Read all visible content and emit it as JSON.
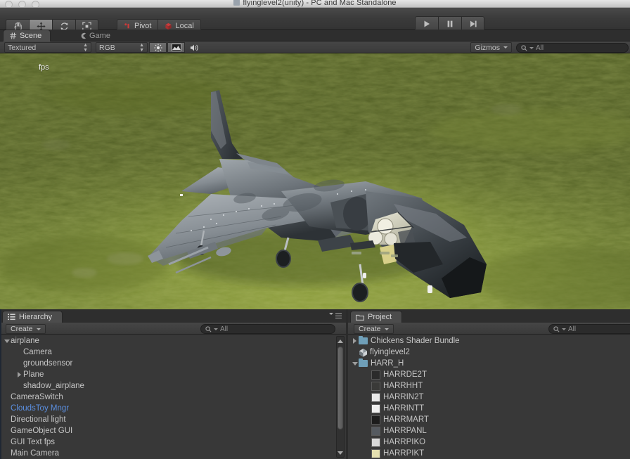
{
  "window": {
    "title": "flyinglevel2(unity) - PC and Mac Standalone",
    "buttons": [
      "close",
      "minimize",
      "zoom"
    ]
  },
  "toolbar": {
    "transform_tools": [
      {
        "name": "hand-tool",
        "icon": "hand-icon",
        "selected": false
      },
      {
        "name": "move-tool",
        "icon": "move-icon",
        "selected": true
      },
      {
        "name": "rotate-tool",
        "icon": "rotate-icon",
        "selected": false
      },
      {
        "name": "scale-tool",
        "icon": "scale-icon",
        "selected": false
      }
    ],
    "pivot_label": "Pivot",
    "local_label": "Local",
    "playback": [
      {
        "name": "play-button",
        "icon": "play-icon"
      },
      {
        "name": "pause-button",
        "icon": "pause-icon"
      },
      {
        "name": "step-button",
        "icon": "step-icon"
      }
    ]
  },
  "view_tabs": [
    {
      "label": "Scene",
      "icon": "scene-grid-icon",
      "active": true
    },
    {
      "label": "Game",
      "icon": "game-pacman-icon",
      "active": false
    }
  ],
  "scene_toolbar": {
    "draw_mode": "Textured",
    "render_mode": "RGB",
    "toggles": [
      {
        "name": "lighting-toggle",
        "icon": "sun-icon",
        "on": true
      },
      {
        "name": "fx-toggle",
        "icon": "image-icon",
        "on": false
      },
      {
        "name": "audio-toggle",
        "icon": "speaker-icon",
        "on": false
      }
    ],
    "gizmos_label": "Gizmos",
    "search_placeholder": "All",
    "search_icon": "search-icon"
  },
  "scene": {
    "overlay_text": "fps",
    "model": "harrier-jet",
    "ground_color": "#7b8c33"
  },
  "hierarchy": {
    "tab_label": "Hierarchy",
    "tab_icon": "hierarchy-list-icon",
    "create_label": "Create",
    "search_placeholder": "All",
    "items": [
      {
        "label": "airplane",
        "depth": 0,
        "expander": "down",
        "selected": false
      },
      {
        "label": "Camera",
        "depth": 1,
        "expander": "none",
        "selected": false
      },
      {
        "label": "groundsensor",
        "depth": 1,
        "expander": "none",
        "selected": false
      },
      {
        "label": "Plane",
        "depth": 1,
        "expander": "right",
        "selected": false
      },
      {
        "label": "shadow_airplane",
        "depth": 1,
        "expander": "none",
        "selected": false
      },
      {
        "label": "CameraSwitch",
        "depth": 0,
        "expander": "none",
        "selected": false
      },
      {
        "label": "CloudsToy Mngr",
        "depth": 0,
        "expander": "none",
        "selected": true
      },
      {
        "label": "Directional light",
        "depth": 0,
        "expander": "none",
        "selected": false
      },
      {
        "label": "GameObject GUI",
        "depth": 0,
        "expander": "none",
        "selected": false
      },
      {
        "label": "GUI Text fps",
        "depth": 0,
        "expander": "none",
        "selected": false
      },
      {
        "label": "Main Camera",
        "depth": 0,
        "expander": "none",
        "selected": false
      }
    ],
    "selected_color": "#5b8fe0"
  },
  "project": {
    "tab_label": "Project",
    "tab_icon": "folder-icon",
    "create_label": "Create",
    "search_placeholder": "All",
    "items": [
      {
        "label": "Chickens Shader Bundle",
        "depth": 0,
        "expander": "right",
        "icon": "folder-icon"
      },
      {
        "label": "flyinglevel2",
        "depth": 0,
        "expander": "none",
        "icon": "unity-scene-icon"
      },
      {
        "label": "HARR_H",
        "depth": 0,
        "expander": "down",
        "icon": "folder-icon"
      },
      {
        "label": "HARRDE2T",
        "depth": 1,
        "expander": "none",
        "icon": "texture-thumb",
        "thumb": "#2b2b2b"
      },
      {
        "label": "HARRHHT",
        "depth": 1,
        "expander": "none",
        "icon": "texture-thumb",
        "thumb": "#3a3a38"
      },
      {
        "label": "HARRIN2T",
        "depth": 1,
        "expander": "none",
        "icon": "texture-thumb",
        "thumb": "#e8e8e8"
      },
      {
        "label": "HARRINTT",
        "depth": 1,
        "expander": "none",
        "icon": "texture-thumb",
        "thumb": "#eeeeee"
      },
      {
        "label": "HARRMART",
        "depth": 1,
        "expander": "none",
        "icon": "texture-thumb",
        "thumb": "#1c1c1c"
      },
      {
        "label": "HARRPANL",
        "depth": 1,
        "expander": "none",
        "icon": "texture-thumb",
        "thumb": "#555a60"
      },
      {
        "label": "HARRPIKO",
        "depth": 1,
        "expander": "none",
        "icon": "texture-thumb",
        "thumb": "#d8d8d8"
      },
      {
        "label": "HARRPIKT",
        "depth": 1,
        "expander": "none",
        "icon": "texture-thumb",
        "thumb": "#e5e0b0"
      }
    ]
  }
}
